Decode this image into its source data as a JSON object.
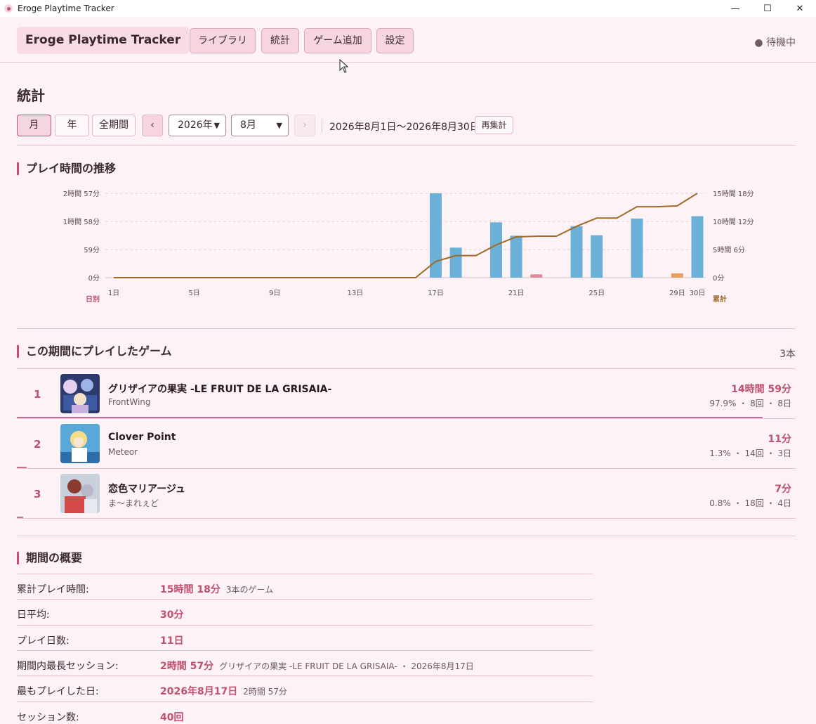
{
  "window": {
    "title": "Eroge Playtime Tracker",
    "minimize": "—",
    "maximize": "☐",
    "close": "✕"
  },
  "header": {
    "brand": "Eroge Playtime Tracker",
    "nav": [
      "ライブラリ",
      "統計",
      "ゲーム追加",
      "設定"
    ],
    "status": "● 待機中"
  },
  "stats": {
    "title": "統計",
    "period_tabs": [
      "月",
      "年",
      "全期間"
    ],
    "active_tab": "月",
    "prev": "‹",
    "next": "›",
    "year": "2026年",
    "month": "8月",
    "range": "2026年8月1日〜2026年8月30日",
    "recalc": "再集計"
  },
  "chart_section": {
    "title": "プレイ時間の推移"
  },
  "chart_data": {
    "type": "bar+line",
    "x_ticks": [
      "1日",
      "5日",
      "9日",
      "13日",
      "17日",
      "21日",
      "25日",
      "29日",
      "30日"
    ],
    "left_axis_label": "日別",
    "right_axis_label": "累計",
    "left_ticks": [
      "0分",
      "59分",
      "1時間 58分",
      "2時間 57分"
    ],
    "right_ticks": [
      "0分",
      "5時間 6分",
      "10時間 12分",
      "15時間 18分"
    ],
    "left_max_min": 177,
    "right_max_min": 918,
    "days": [
      1,
      2,
      3,
      4,
      5,
      6,
      7,
      8,
      9,
      10,
      11,
      12,
      13,
      14,
      15,
      16,
      17,
      18,
      19,
      20,
      21,
      22,
      23,
      24,
      25,
      26,
      27,
      28,
      29,
      30
    ],
    "daily_series": [
      {
        "name": "グリザイアの果実 -LE FRUIT DE LA GRISAIA-",
        "color": "#6bb0d6",
        "values": [
          0,
          0,
          0,
          0,
          0,
          0,
          0,
          0,
          0,
          0,
          0,
          0,
          0,
          0,
          0,
          0,
          177,
          63,
          0,
          116,
          88,
          0,
          0,
          108,
          89,
          0,
          124,
          0,
          0,
          129
        ]
      },
      {
        "name": "Clover Point",
        "color": "#e08a9a",
        "values": [
          0,
          0,
          0,
          0,
          0,
          0,
          0,
          0,
          0,
          0,
          0,
          0,
          0,
          0,
          0,
          0,
          0,
          0,
          0,
          0,
          0,
          7,
          0,
          0,
          0,
          0,
          0,
          0,
          0,
          0
        ]
      },
      {
        "name": "恋色マリアージュ",
        "color": "#e8a060",
        "values": [
          0,
          0,
          0,
          0,
          0,
          0,
          0,
          0,
          0,
          0,
          0,
          0,
          0,
          0,
          0,
          0,
          0,
          0,
          0,
          0,
          0,
          0,
          0,
          0,
          0,
          0,
          0,
          0,
          9,
          0
        ]
      }
    ],
    "cumulative": [
      0,
      0,
      0,
      0,
      0,
      0,
      0,
      0,
      0,
      0,
      0,
      0,
      0,
      0,
      0,
      0,
      177,
      240,
      240,
      356,
      444,
      451,
      451,
      559,
      648,
      648,
      772,
      772,
      781,
      918
    ],
    "line_color": "#a06a28"
  },
  "games_section": {
    "title": "この期間にプレイしたゲーム",
    "count": "3本",
    "games": [
      {
        "rank": "1",
        "title": "グリザイアの果実 -LE FRUIT DE LA GRISAIA-",
        "developer": "FrontWing",
        "time": "14時間 59分",
        "share": "97.9%",
        "sessions": "8回",
        "days": "8日",
        "share_value": 0.979
      },
      {
        "rank": "2",
        "title": "Clover Point",
        "developer": "Meteor",
        "time": "11分",
        "share": "1.3%",
        "sessions": "14回",
        "days": "3日",
        "share_value": 0.013
      },
      {
        "rank": "3",
        "title": "恋色マリアージュ",
        "developer": "ま〜まれぇど",
        "time": "7分",
        "share": "0.8%",
        "sessions": "18回",
        "days": "4日",
        "share_value": 0.008
      }
    ]
  },
  "summary": {
    "title": "期間の概要",
    "rows": [
      {
        "label": "累計プレイ時間:",
        "value": "15時間 18分",
        "note": "3本のゲーム"
      },
      {
        "label": "日平均:",
        "value": "30分",
        "note": ""
      },
      {
        "label": "プレイ日数:",
        "value": "11日",
        "note": ""
      },
      {
        "label": "期間内最長セッション:",
        "value": "2時間 57分",
        "note": "グリザイアの果実 -LE FRUIT DE LA GRISAIA- ・ 2026年8月17日"
      },
      {
        "label": "最もプレイした日:",
        "value": "2026年8月17日",
        "note": "2時間 57分"
      },
      {
        "label": "セッション数:",
        "value": "40回",
        "note": ""
      }
    ]
  }
}
